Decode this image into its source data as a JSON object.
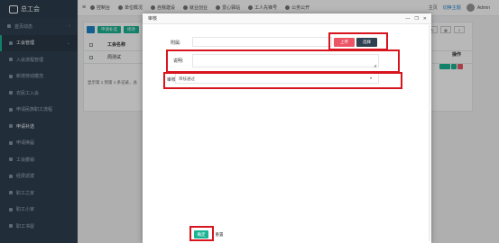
{
  "app": {
    "title": "总工会"
  },
  "sidebar": {
    "items": [
      {
        "label": "首页动态",
        "level": "top",
        "caret": "‹"
      },
      {
        "label": "工会管理",
        "level": "top",
        "active": true,
        "caret": "⌄"
      },
      {
        "label": "入会流程管理",
        "level": "sub"
      },
      {
        "label": "新增劳动模范",
        "level": "sub"
      },
      {
        "label": "农民工入会",
        "level": "sub"
      },
      {
        "label": "申请民族职工流程",
        "level": "sub"
      },
      {
        "label": "申请补选",
        "level": "sub",
        "current": true
      },
      {
        "label": "申请换届",
        "level": "sub"
      },
      {
        "label": "工会撤销",
        "level": "sub"
      },
      {
        "label": "经费返拨",
        "level": "sub"
      },
      {
        "label": "职工之家",
        "level": "sub"
      },
      {
        "label": "职工小家",
        "level": "sub"
      },
      {
        "label": "职工书屋",
        "level": "sub"
      }
    ]
  },
  "topbar": {
    "menu_icon": "≡",
    "items": [
      "控制台",
      "单位概况",
      "自我建设",
      "就业创业",
      "爱心驿站",
      "工人先锋号",
      "公务公开"
    ],
    "right": {
      "home": "主页",
      "theme": "切换主题",
      "user": "Admin"
    }
  },
  "content": {
    "buttons": [
      "申请补选",
      "修改"
    ],
    "table": {
      "headers": [
        "工会名称",
        "操作"
      ],
      "rows": [
        [
          "周测试"
        ]
      ]
    },
    "footer": "显示第 1 到第 1 条记录，总"
  },
  "modal": {
    "title": "审核",
    "controls": [
      "—",
      "❐",
      "✕"
    ],
    "fields": {
      "attachment_label": "附属:",
      "description_label": "说明:",
      "review_label": "审核结果:",
      "review_value": "审核通过"
    },
    "buttons": {
      "upload": "上传",
      "choose": "选择",
      "confirm": "确定",
      "reset": "重置"
    }
  },
  "colors": {
    "sidebar": "#2f4050",
    "accent": "#1ab394",
    "danger": "#ed5565",
    "annotation": "#d8141d"
  }
}
